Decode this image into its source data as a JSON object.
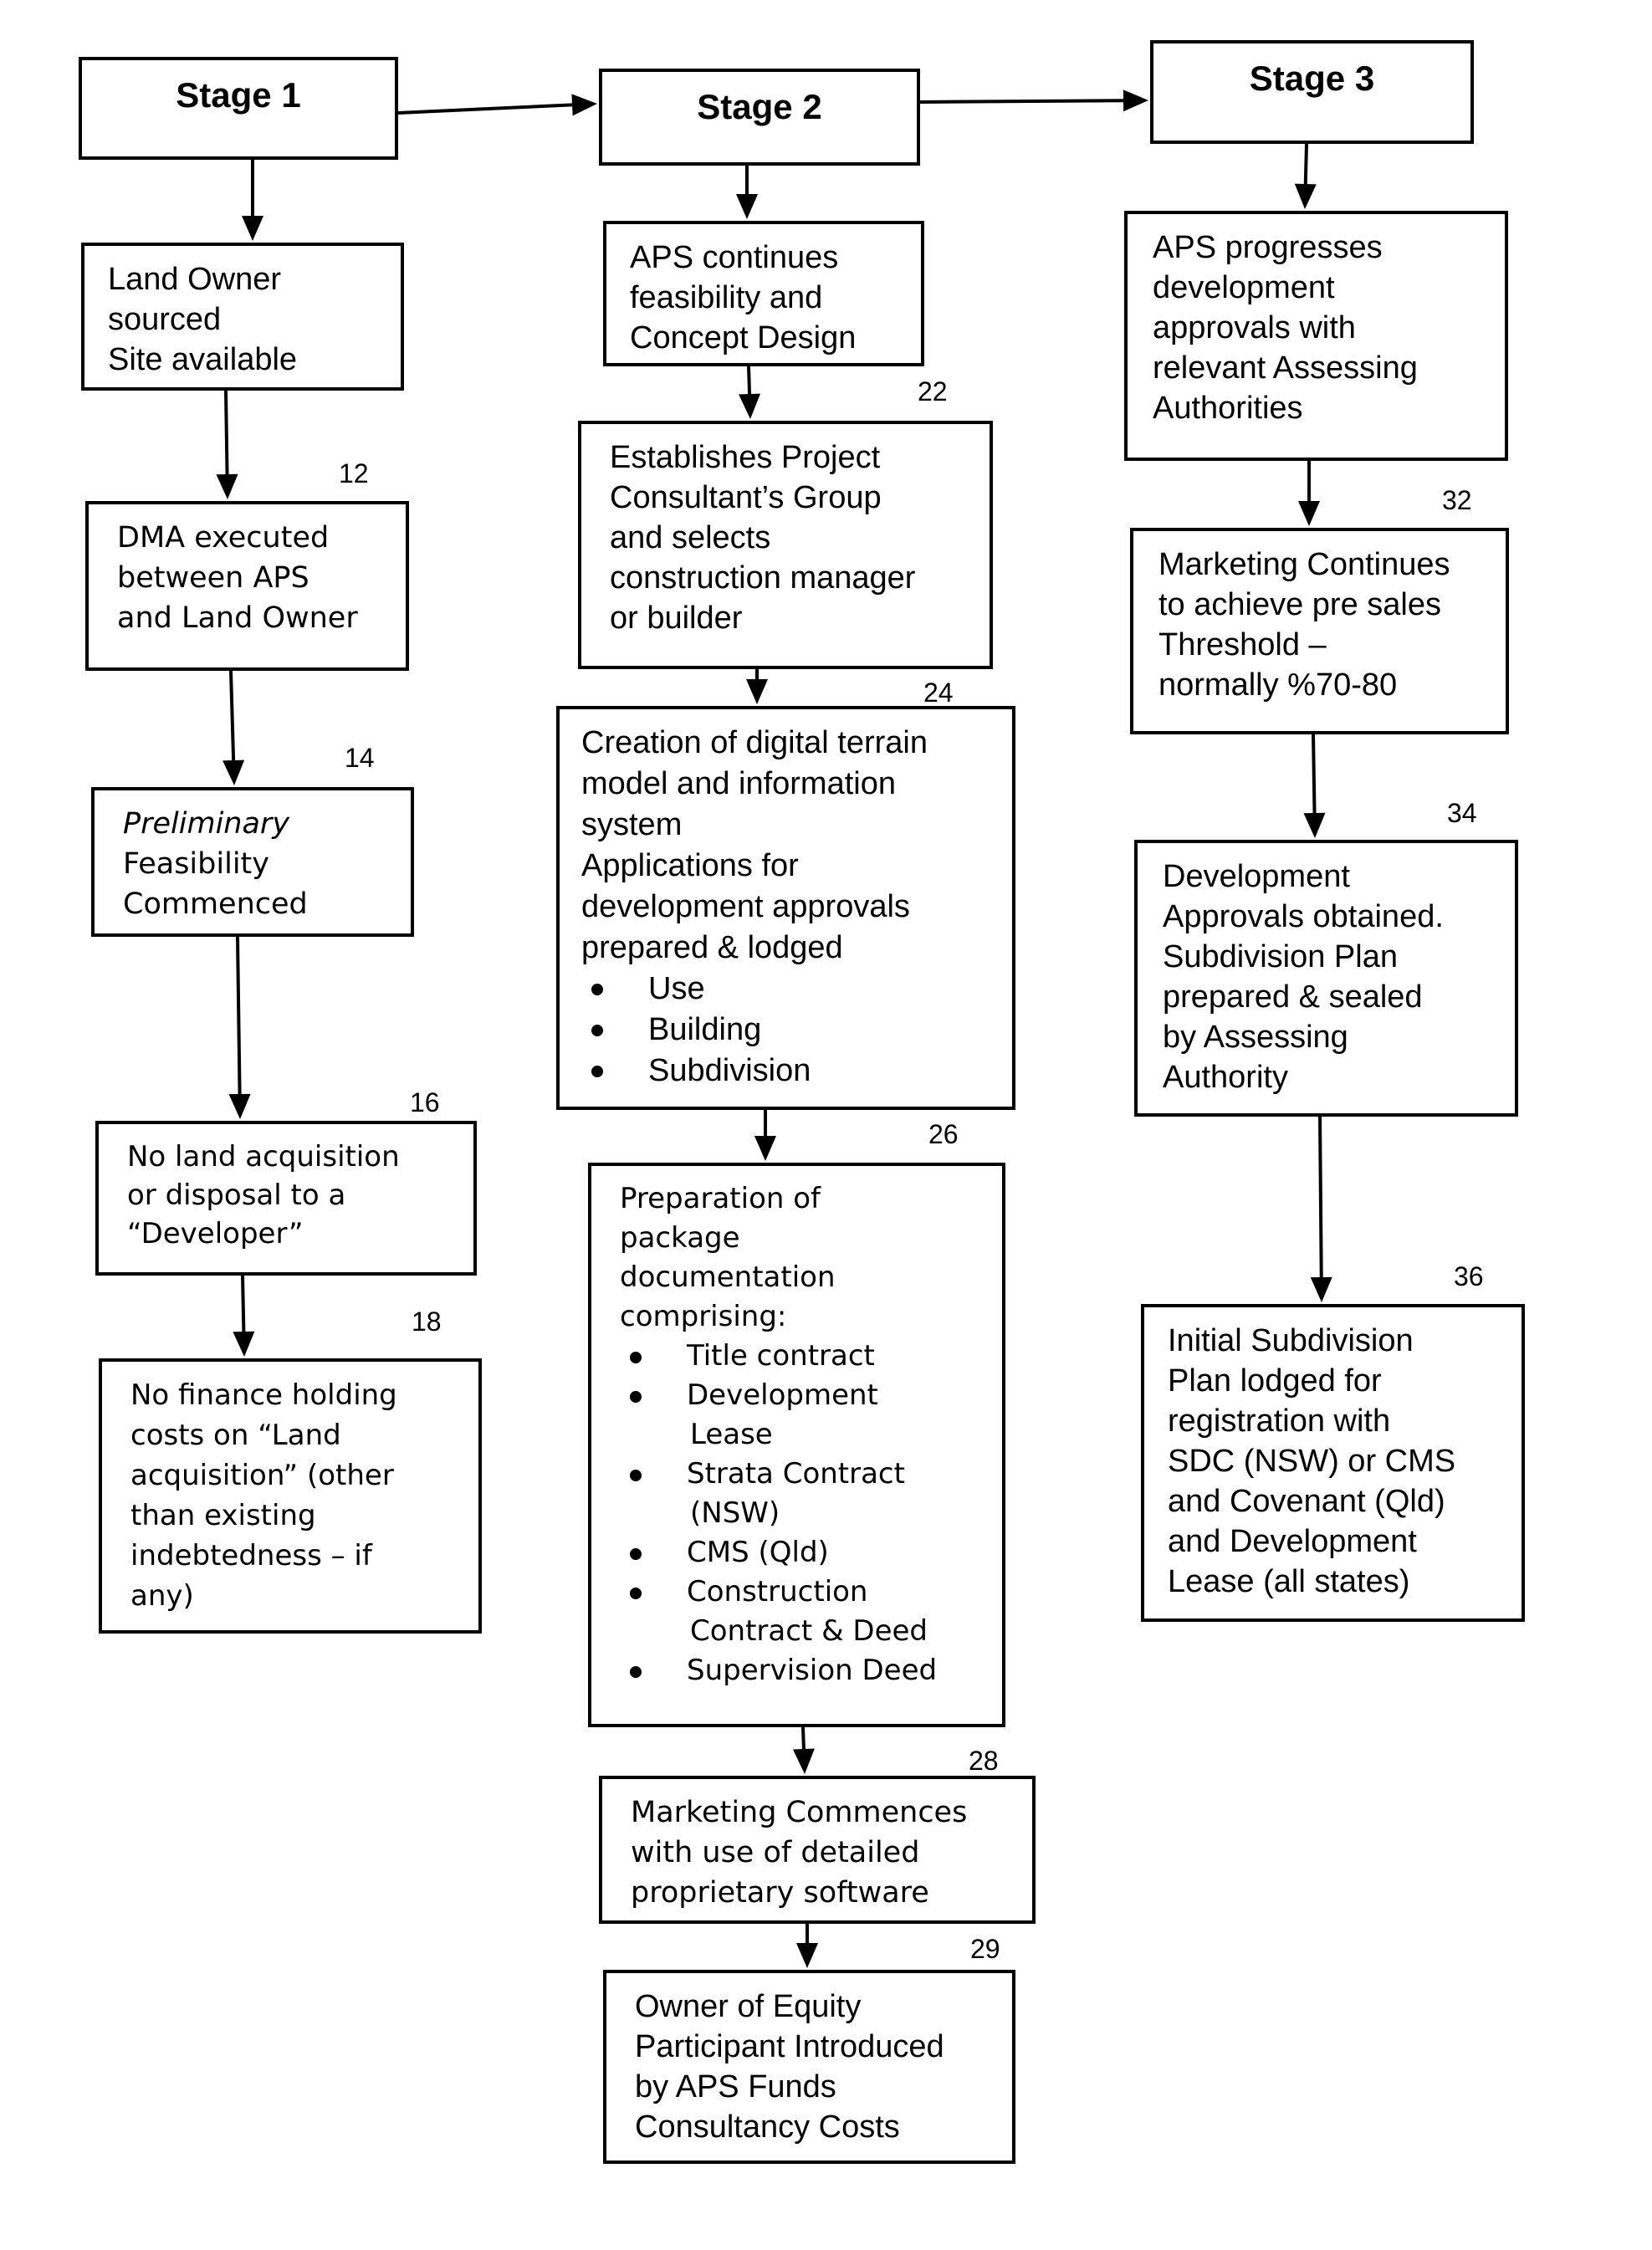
{
  "stages": [
    {
      "id": "stage1",
      "title": "Stage 1"
    },
    {
      "id": "stage2",
      "title": "Stage 2"
    },
    {
      "id": "stage3",
      "title": "Stage 3"
    }
  ],
  "column1": [
    {
      "ref": "",
      "lines": [
        "Land Owner",
        "sourced",
        "Site available"
      ]
    },
    {
      "ref": "12",
      "lines": [
        "DMA executed",
        "between APS",
        "and Land Owner"
      ]
    },
    {
      "ref": "14",
      "lines": [
        "Preliminary",
        "Feasibility",
        "Commenced"
      ]
    },
    {
      "ref": "16",
      "lines": [
        "No land acquisition",
        "or disposal to a",
        "“Developer”"
      ]
    },
    {
      "ref": "18",
      "lines": [
        "No finance holding",
        "costs on “Land",
        "acquisition” (other",
        "than existing",
        "indebtedness – if",
        "any)"
      ]
    }
  ],
  "column2": [
    {
      "ref": "",
      "lines": [
        "APS continues",
        "feasibility and",
        "Concept Design"
      ]
    },
    {
      "ref": "22",
      "lines": [
        "Establishes Project",
        "Consultant’s Group",
        "and selects",
        "construction manager",
        "or builder"
      ]
    },
    {
      "ref": "24",
      "lines": [
        "Creation of digital terrain",
        "model and information",
        "system",
        "Applications for",
        "development approvals",
        "prepared & lodged"
      ],
      "bullets": [
        [
          "Use"
        ],
        [
          "Building"
        ],
        [
          "Subdivision"
        ]
      ]
    },
    {
      "ref": "26",
      "lines": [
        "Preparation of",
        "package",
        "documentation",
        "comprising:"
      ],
      "bullets": [
        [
          "Title contract"
        ],
        [
          "Development",
          "Lease"
        ],
        [
          "Strata Contract",
          "(NSW)"
        ],
        [
          "CMS (Qld)"
        ],
        [
          "Construction",
          "Contract & Deed"
        ],
        [
          "Supervision Deed"
        ]
      ]
    },
    {
      "ref": "28",
      "lines": [
        "Marketing Commences",
        "with use of detailed",
        "proprietary software"
      ]
    },
    {
      "ref": "29",
      "lines": [
        "Owner of Equity",
        "Participant Introduced",
        "by APS Funds",
        "Consultancy Costs"
      ]
    }
  ],
  "column3": [
    {
      "ref": "",
      "lines": [
        "APS progresses",
        "development",
        "approvals with",
        "relevant Assessing",
        "Authorities"
      ]
    },
    {
      "ref": "32",
      "lines": [
        "Marketing Continues",
        "to achieve pre sales",
        "Threshold –",
        "normally %70-80"
      ]
    },
    {
      "ref": "34",
      "lines": [
        "Development",
        "Approvals obtained.",
        "Subdivision Plan",
        "prepared & sealed",
        "by Assessing",
        "Authority"
      ]
    },
    {
      "ref": "36",
      "lines": [
        "Initial Subdivision",
        "Plan lodged for",
        "registration with",
        "SDC (NSW) or CMS",
        "and Covenant (Qld)",
        "and Development",
        "Lease (all states)"
      ]
    }
  ],
  "colors": {
    "line": "#000000",
    "background": "#ffffff"
  }
}
